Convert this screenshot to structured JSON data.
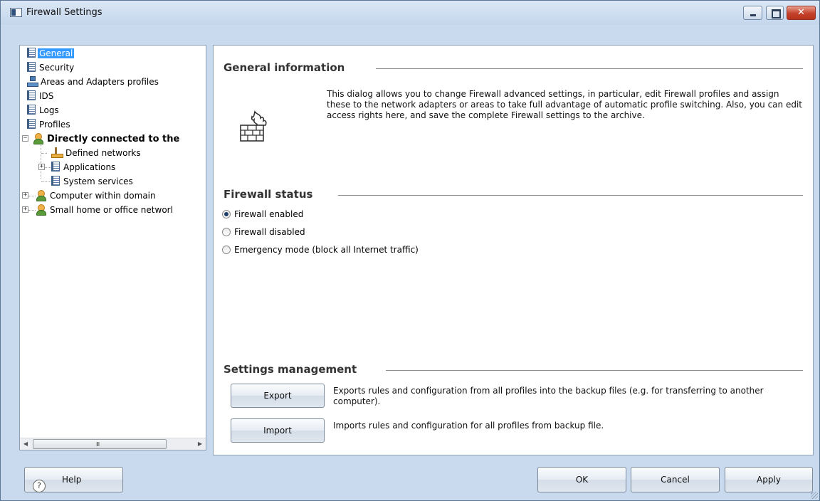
{
  "window": {
    "title": "Firewall Settings"
  },
  "tree": {
    "items": [
      {
        "label": "General",
        "icon": "document-icon",
        "selected": true
      },
      {
        "label": "Security",
        "icon": "document-icon"
      },
      {
        "label": "Areas and Adapters profiles",
        "icon": "network-icon"
      },
      {
        "label": "IDS",
        "icon": "document-icon"
      },
      {
        "label": "Logs",
        "icon": "document-icon"
      },
      {
        "label": "Profiles",
        "icon": "document-icon"
      },
      {
        "label": "Directly connected to the",
        "icon": "person-icon",
        "bold": true,
        "expanded": true
      },
      {
        "label": "Defined networks",
        "icon": "network-icon"
      },
      {
        "label": "Applications",
        "icon": "document-icon"
      },
      {
        "label": "System services",
        "icon": "document-icon"
      },
      {
        "label": "Computer within domain",
        "icon": "person-icon"
      },
      {
        "label": "Small home or office networl",
        "icon": "person-icon"
      }
    ],
    "scroll_grip": "III"
  },
  "general_info": {
    "title": "General information",
    "description": "This dialog allows you to change Firewall advanced settings, in particular, edit Firewall profiles and assign these to the network adapters or areas to take full advantage of automatic profile switching. Also, you can edit access rights here, and save the complete Firewall settings to the archive.",
    "icon": "firewall-brick-icon"
  },
  "firewall_status": {
    "title": "Firewall status",
    "options": [
      {
        "label": "Firewall enabled",
        "checked": true
      },
      {
        "label": "Firewall disabled",
        "checked": false
      },
      {
        "label": "Emergency mode (block all Internet traffic)",
        "checked": false
      }
    ]
  },
  "settings_management": {
    "title": "Settings management",
    "export_label": "Export",
    "export_desc": "Exports rules and configuration from all profiles into the backup files (e.g. for transferring to another computer).",
    "import_label": "Import",
    "import_desc": "Imports rules and configuration for all profiles from backup file."
  },
  "footer": {
    "help_label": "Help",
    "help_icon": "?",
    "ok_label": "OK",
    "cancel_label": "Cancel",
    "apply_label": "Apply"
  }
}
